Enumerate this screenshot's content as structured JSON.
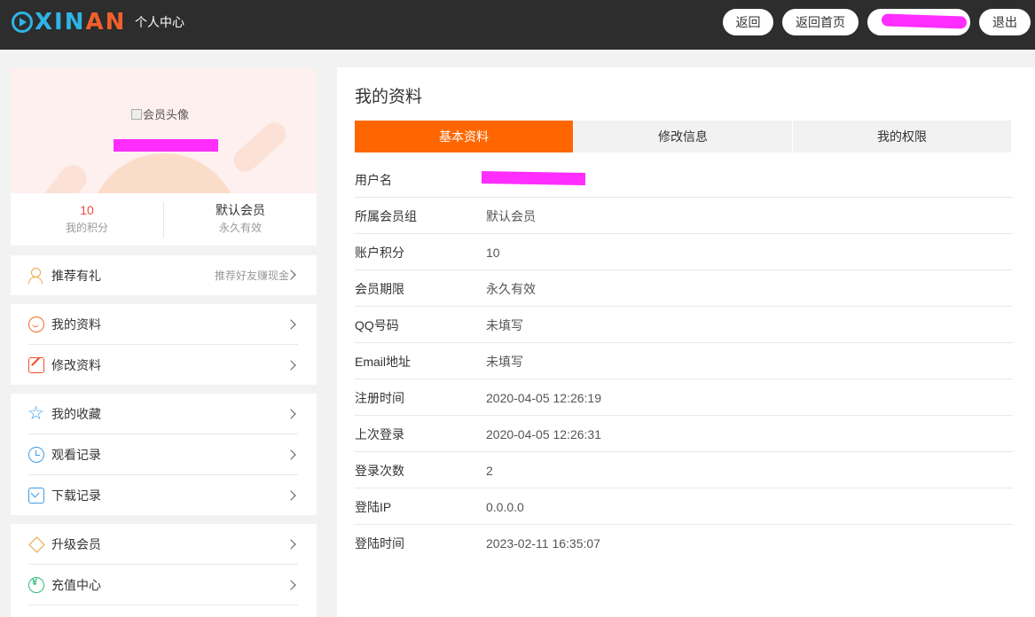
{
  "header": {
    "logo_a": "Ｃ",
    "logo_b": "XIN",
    "logo_c": "AN",
    "title": "个人中心",
    "buttons": {
      "back": "返回",
      "home": "返回首页",
      "logout": "退出"
    }
  },
  "profile": {
    "avatar_alt": "会员头像",
    "points_value": "10",
    "points_label": "我的积分",
    "group_value": "默认会员",
    "group_label": "永久有效"
  },
  "menu": {
    "referral": {
      "label": "推荐有礼",
      "extra": "推荐好友赚现金",
      "icon": "user-add-icon"
    },
    "my_profile": {
      "label": "我的资料",
      "icon": "smile-icon"
    },
    "edit_profile": {
      "label": "修改资料",
      "icon": "edit-icon"
    },
    "favorites": {
      "label": "我的收藏",
      "icon": "star-icon"
    },
    "history": {
      "label": "观看记录",
      "icon": "clock-icon"
    },
    "downloads": {
      "label": "下载记录",
      "icon": "download-icon"
    },
    "upgrade": {
      "label": "升级会员",
      "icon": "diamond-icon"
    },
    "recharge": {
      "label": "充值中心",
      "icon": "recharge-icon"
    }
  },
  "panel": {
    "title": "我的资料",
    "tabs": [
      "基本资料",
      "修改信息",
      "我的权限"
    ],
    "rows": [
      {
        "key": "用户名",
        "value": ""
      },
      {
        "key": "所属会员组",
        "value": "默认会员"
      },
      {
        "key": "账户积分",
        "value": "10"
      },
      {
        "key": "会员期限",
        "value": "永久有效"
      },
      {
        "key": "QQ号码",
        "value": "未填写"
      },
      {
        "key": "Email地址",
        "value": "未填写"
      },
      {
        "key": "注册时间",
        "value": "2020-04-05 12:26:19"
      },
      {
        "key": "上次登录",
        "value": "2020-04-05 12:26:31"
      },
      {
        "key": "登录次数",
        "value": "2"
      },
      {
        "key": "登陆IP",
        "value": "0.0.0.0"
      },
      {
        "key": "登陆时间",
        "value": "2023-02-11 16:35:07"
      }
    ]
  },
  "colors": {
    "accent": "#ff6600",
    "header_bg": "#2d2d2d",
    "points": "#e84c3d",
    "redaction": "#ff2dff"
  }
}
